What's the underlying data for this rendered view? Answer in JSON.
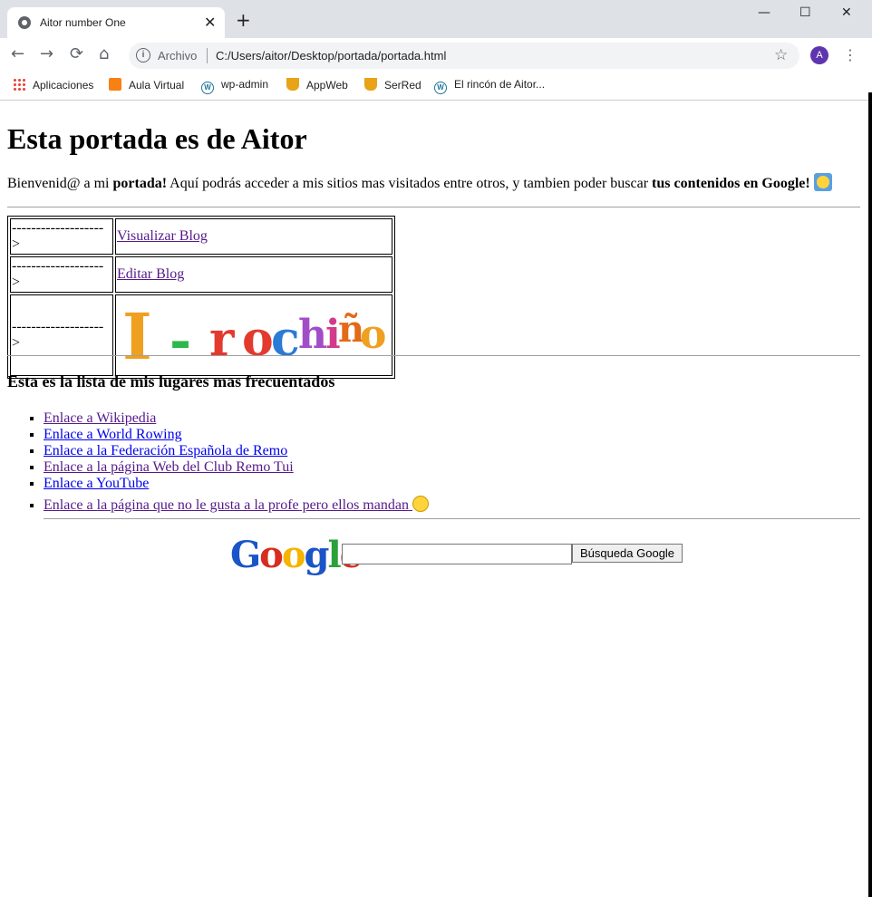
{
  "browser": {
    "tab_title": "Aitor number One",
    "tab_close": "✕",
    "new_tab": "+",
    "window_controls": {
      "minimize": "—",
      "maximize": "☐",
      "close": "✕"
    },
    "nav": {
      "back": "←",
      "forward": "→",
      "reload": "⟳",
      "home": "⌂"
    },
    "address": {
      "scheme_label": "Archivo",
      "url": "C:/Users/aitor/Desktop/portada/portada.html"
    },
    "profile_initial": "A",
    "menu": "⋮",
    "bookmarks": [
      {
        "label": "Aplicaciones",
        "icon": "apps-grid-icon"
      },
      {
        "label": "Aula Virtual",
        "icon": "moodle-icon"
      },
      {
        "label": "wp-admin",
        "icon": "wordpress-icon"
      },
      {
        "label": "AppWeb",
        "icon": "trophy-icon"
      },
      {
        "label": "SerRed",
        "icon": "trophy-icon"
      },
      {
        "label": "El rincón de Aitor...",
        "icon": "wordpress-icon"
      }
    ]
  },
  "page": {
    "heading": "Esta portada es de Aitor",
    "intro": {
      "part1": "Bienvenid@ a mi ",
      "bold1": "portada!",
      "part2": " Aquí podrás acceder a mis sitios mas visitados entre otros, y tambien poder buscar ",
      "bold2": "tus contenidos en Google!"
    },
    "table": {
      "arrow": "------------------->",
      "rows": [
        {
          "link": "Visualizar Blog"
        },
        {
          "link": "Editar Blog"
        }
      ],
      "logo_text": "I-rochiño"
    },
    "list_heading": "Esta es la lista de mis lugares mas frecuentados",
    "links": [
      "Enlace a Wikipedia",
      "Enlace a World Rowing",
      "Enlace a la Federación Española de Remo",
      "Enlace a la página Web del Club Remo Tui",
      "Enlace a YouTube",
      "Enlace a la página que no le gusta a la profe pero ellos mandan"
    ],
    "search": {
      "logo_letters": [
        "G",
        "o",
        "o",
        "g",
        "l",
        "e"
      ],
      "logo_colors": [
        "#1a55c8",
        "#d62d20",
        "#f4b400",
        "#1a55c8",
        "#2aa13b",
        "#d62d20"
      ],
      "tm": "™",
      "button_label": "Búsqueda Google",
      "input_value": ""
    }
  }
}
